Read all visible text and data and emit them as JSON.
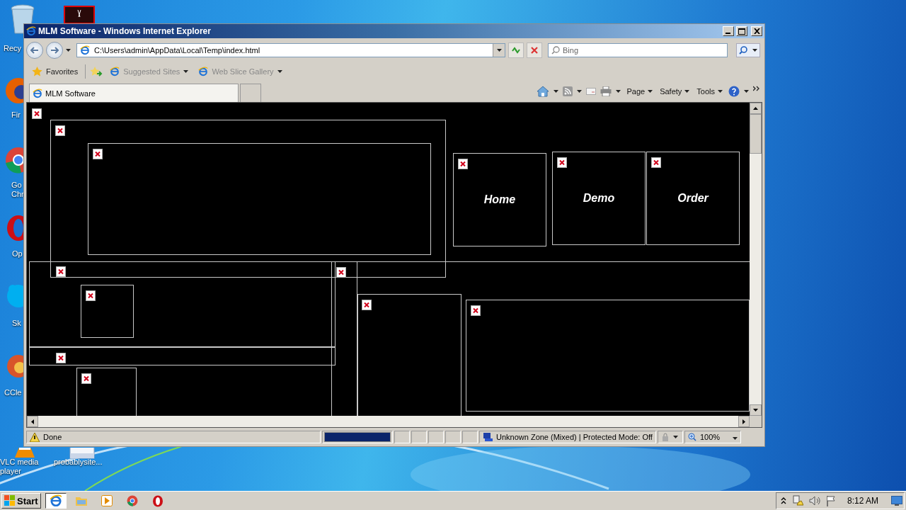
{
  "desktop_icons": [
    {
      "kind": "recycle",
      "lines": [
        "Recy"
      ]
    },
    {
      "kind": "pdf"
    },
    {
      "kind": "firefox",
      "lines": [
        "Fir"
      ]
    },
    {
      "kind": "chrome",
      "lines": [
        "Go",
        "Chr"
      ]
    },
    {
      "kind": "opera",
      "lines": [
        "Op"
      ]
    },
    {
      "kind": "skype",
      "lines": [
        "Sk"
      ]
    },
    {
      "kind": "ccleaner",
      "lines": [
        "CCle"
      ]
    },
    {
      "kind": "vlc",
      "lines": [
        "VLC media",
        "player"
      ]
    },
    {
      "kind": "file",
      "lines": [
        "probablysite..."
      ]
    }
  ],
  "window": {
    "title": "MLM Software - Windows Internet Explorer",
    "address": "C:\\Users\\admin\\AppData\\Local\\Temp\\index.html",
    "search": {
      "placeholder": "Bing"
    },
    "favorites": {
      "label": "Favorites",
      "links": [
        "Suggested Sites",
        "Web Slice Gallery"
      ]
    },
    "tabs": [
      {
        "label": "MLM Software",
        "selected": true
      }
    ],
    "commands": [
      "Page",
      "Safety",
      "Tools"
    ],
    "page": {
      "nav": [
        "Home",
        "Demo",
        "Order"
      ]
    },
    "status_bar": {
      "text": "Done",
      "progress": {
        "level": 1
      },
      "zone": "Unknown Zone (Mixed) | Protected Mode: Off",
      "zoom": "100%"
    }
  },
  "taskbar": {
    "start": "Start",
    "apps": [
      {
        "kind": "ie",
        "selected": true
      },
      {
        "kind": "explorer",
        "selected": false
      },
      {
        "kind": "media",
        "selected": false
      },
      {
        "kind": "chrome",
        "selected": false
      },
      {
        "kind": "opera",
        "selected": false
      }
    ],
    "clock": "8:12 AM"
  }
}
